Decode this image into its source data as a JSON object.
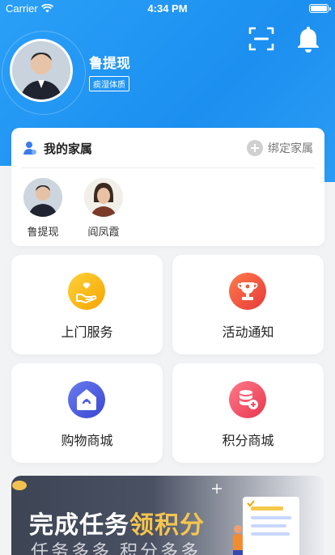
{
  "status_bar": {
    "carrier": "Carrier",
    "time": "4:34 PM"
  },
  "header": {
    "icons": [
      "scan-icon",
      "bell-icon"
    ],
    "user": {
      "name": "鲁提现",
      "tag": "痰湿体质"
    }
  },
  "family": {
    "title": "我的家属",
    "bind_label": "绑定家属",
    "members": [
      {
        "name": "鲁提现"
      },
      {
        "name": "阎凤霞"
      }
    ]
  },
  "tiles": [
    {
      "label": "上门服务",
      "icon": "home-service-icon",
      "color": "#f5b400"
    },
    {
      "label": "活动通知",
      "icon": "trophy-icon",
      "color": "#ef5a3c"
    },
    {
      "label": "购物商城",
      "icon": "shop-icon",
      "color": "#4a5ce0"
    },
    {
      "label": "积分商城",
      "icon": "points-icon",
      "color": "#ef4f6b"
    }
  ],
  "banner": {
    "title_a": "完成任务",
    "title_b": "领积分",
    "subtitle": "任务多多 积分多多"
  },
  "colors": {
    "primary": "#1c8ff0",
    "accent": "#f6c54d"
  }
}
